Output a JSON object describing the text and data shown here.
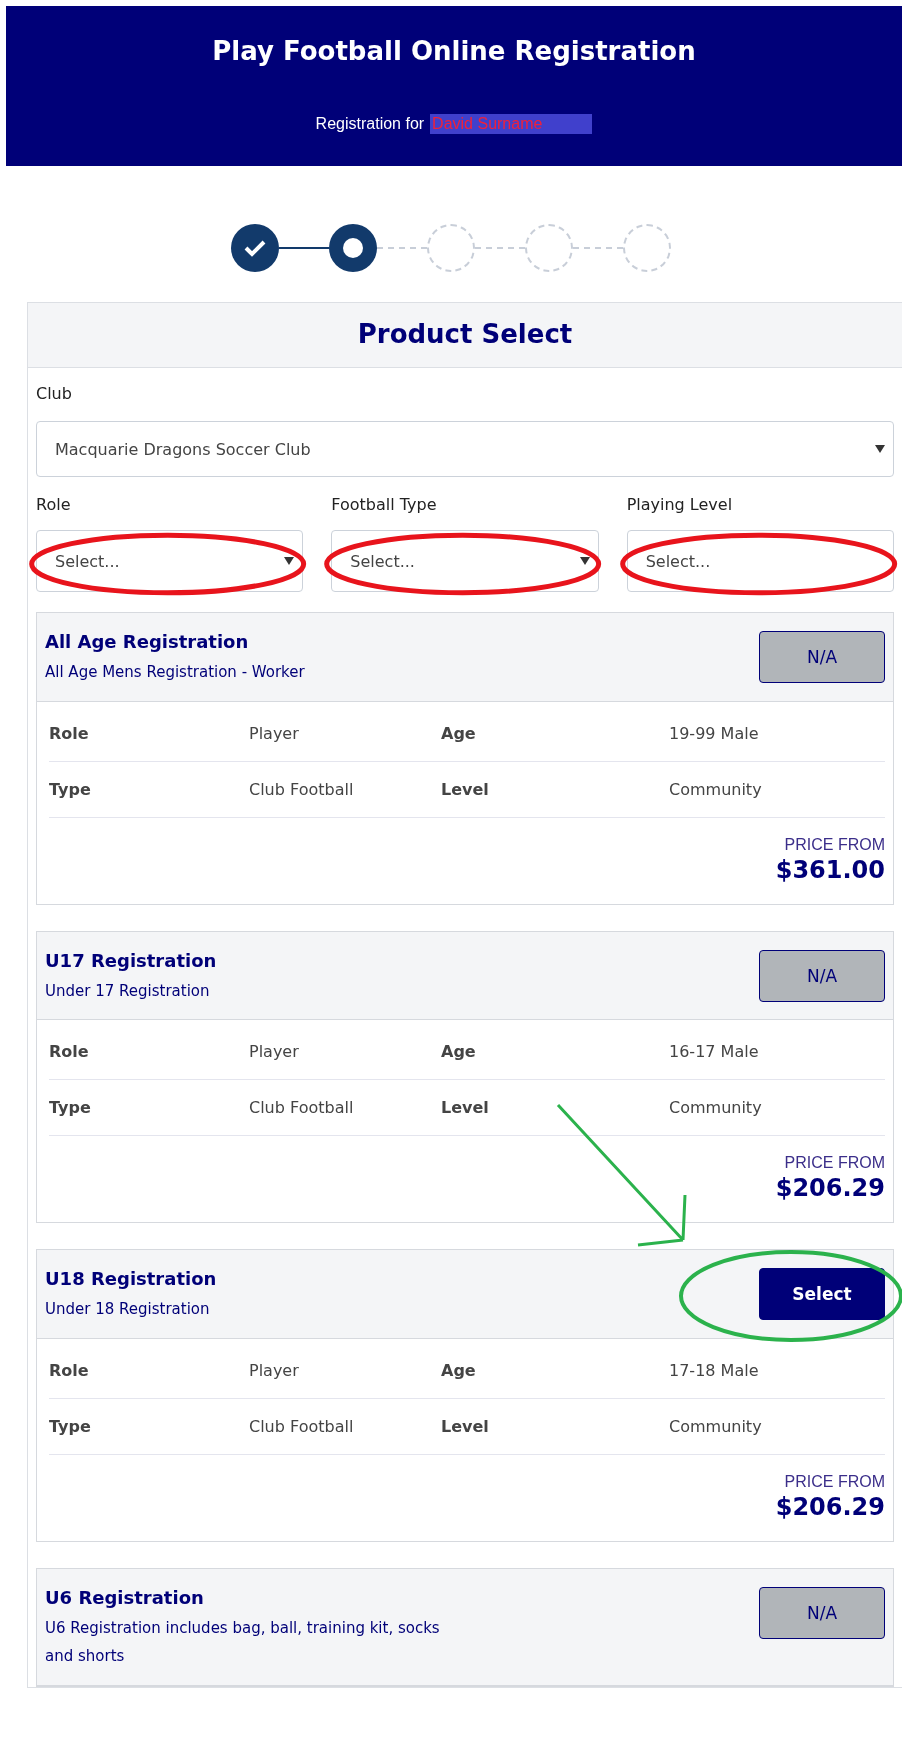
{
  "header": {
    "title": "Play Football Online Registration",
    "subtitle": "Registration for",
    "user_name": "David Surname"
  },
  "steps": [
    {
      "kind": "done"
    },
    {
      "kind": "current"
    },
    {
      "kind": "pending"
    },
    {
      "kind": "pending"
    },
    {
      "kind": "pending"
    }
  ],
  "panel": {
    "title": "Product Select",
    "club": {
      "label": "Club",
      "value": "Macquarie Dragons Soccer Club"
    },
    "filters": [
      {
        "label": "Role",
        "placeholder": "Select...",
        "circled": true
      },
      {
        "label": "Football Type",
        "placeholder": "Select...",
        "circled": true
      },
      {
        "label": "Playing Level",
        "placeholder": "Select...",
        "circled": true
      }
    ]
  },
  "products": [
    {
      "title": "All Age Registration",
      "description": "All Age Mens Registration - Worker",
      "button": "N/A",
      "available": false,
      "circled": false,
      "details": [
        [
          "Role",
          "Player",
          "Age",
          "19-99 Male"
        ],
        [
          "Type",
          "Club Football",
          "Level",
          "Community"
        ]
      ],
      "price_label": "PRICE FROM",
      "price": "$361.00"
    },
    {
      "title": "U17 Registration",
      "description": "Under 17 Registration",
      "button": "N/A",
      "available": false,
      "circled": false,
      "details": [
        [
          "Role",
          "Player",
          "Age",
          "16-17 Male"
        ],
        [
          "Type",
          "Club Football",
          "Level",
          "Community"
        ]
      ],
      "price_label": "PRICE FROM",
      "price": "$206.29"
    },
    {
      "title": "U18 Registration",
      "description": "Under 18 Registration",
      "button": "Select",
      "available": true,
      "circled": true,
      "details": [
        [
          "Role",
          "Player",
          "Age",
          "17-18 Male"
        ],
        [
          "Type",
          "Club Football",
          "Level",
          "Community"
        ]
      ],
      "price_label": "PRICE FROM",
      "price": "$206.29"
    },
    {
      "title": "U6 Registration",
      "description": "U6 Registration includes bag, ball, training kit, socks and shorts",
      "button": "N/A",
      "available": false,
      "circled": false
    }
  ]
}
